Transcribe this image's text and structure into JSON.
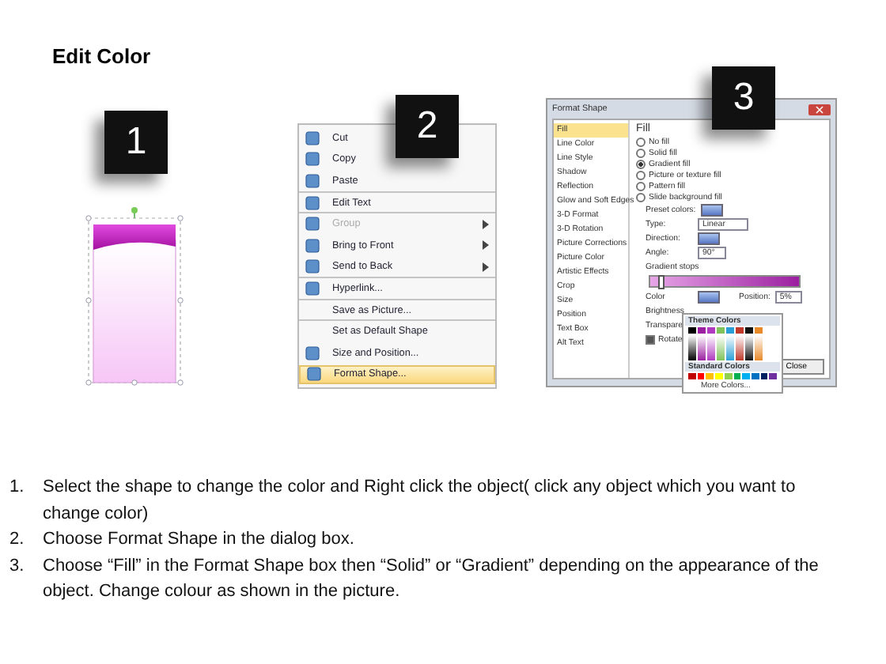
{
  "title": "Edit Color",
  "badges": [
    "1",
    "2",
    "3"
  ],
  "menu": [
    {
      "label": "Cut",
      "icon": true,
      "disabled": false,
      "submenu": false,
      "selected": false,
      "separator_after": false
    },
    {
      "label": "Copy",
      "icon": true,
      "disabled": false,
      "submenu": false,
      "selected": false,
      "separator_after": false
    },
    {
      "label": "Paste",
      "icon": true,
      "disabled": false,
      "submenu": false,
      "selected": false,
      "separator_after": true
    },
    {
      "label": "Edit Text",
      "icon": true,
      "disabled": false,
      "submenu": false,
      "selected": false,
      "separator_after": true
    },
    {
      "label": "Group",
      "icon": true,
      "disabled": true,
      "submenu": true,
      "selected": false,
      "separator_after": false
    },
    {
      "label": "Bring to Front",
      "icon": true,
      "disabled": false,
      "submenu": true,
      "selected": false,
      "separator_after": false
    },
    {
      "label": "Send to Back",
      "icon": true,
      "disabled": false,
      "submenu": true,
      "selected": false,
      "separator_after": true
    },
    {
      "label": "Hyperlink...",
      "icon": true,
      "disabled": false,
      "submenu": false,
      "selected": false,
      "separator_after": true
    },
    {
      "label": "Save as Picture...",
      "icon": false,
      "disabled": false,
      "submenu": false,
      "selected": false,
      "separator_after": true
    },
    {
      "label": "Set as Default Shape",
      "icon": false,
      "disabled": false,
      "submenu": false,
      "selected": false,
      "separator_after": false
    },
    {
      "label": "Size and Position...",
      "icon": true,
      "disabled": false,
      "submenu": false,
      "selected": false,
      "separator_after": false
    },
    {
      "label": "Format Shape...",
      "icon": true,
      "disabled": false,
      "submenu": false,
      "selected": true,
      "separator_after": false
    }
  ],
  "dialog": {
    "title": "Format Shape",
    "sidebar": [
      {
        "label": "Fill",
        "selected": true
      },
      {
        "label": "Line Color",
        "selected": false
      },
      {
        "label": "Line Style",
        "selected": false
      },
      {
        "label": "Shadow",
        "selected": false
      },
      {
        "label": "Reflection",
        "selected": false
      },
      {
        "label": "Glow and Soft Edges",
        "selected": false
      },
      {
        "label": "3-D Format",
        "selected": false
      },
      {
        "label": "3-D Rotation",
        "selected": false
      },
      {
        "label": "Picture Corrections",
        "selected": false
      },
      {
        "label": "Picture Color",
        "selected": false
      },
      {
        "label": "Artistic Effects",
        "selected": false
      },
      {
        "label": "Crop",
        "selected": false
      },
      {
        "label": "Size",
        "selected": false
      },
      {
        "label": "Position",
        "selected": false
      },
      {
        "label": "Text Box",
        "selected": false
      },
      {
        "label": "Alt Text",
        "selected": false
      }
    ],
    "heading": "Fill",
    "options": [
      {
        "label": "No fill",
        "selected": false
      },
      {
        "label": "Solid fill",
        "selected": false
      },
      {
        "label": "Gradient fill",
        "selected": true
      },
      {
        "label": "Picture or texture fill",
        "selected": false
      },
      {
        "label": "Pattern fill",
        "selected": false
      },
      {
        "label": "Slide background fill",
        "selected": false
      }
    ],
    "preset_label": "Preset colors:",
    "type_label": "Type:",
    "type_value": "Linear",
    "direction_label": "Direction:",
    "angle_label": "Angle:",
    "angle_value": "90°",
    "stops_label": "Gradient stops",
    "color_label": "Color",
    "position_label": "Position:",
    "position_value": "5%",
    "brightness_label": "Brightness",
    "transparency_label": "Transpare",
    "rotate_label": "Rotate",
    "rotate_checked": true,
    "gradient_stop": {
      "level": 0.05
    },
    "close": "Close"
  },
  "palette": {
    "theme_title": "Theme Colors",
    "theme": [
      {
        "color": "#000000"
      },
      {
        "color": "#9b1fa0"
      },
      {
        "color": "#b03ac0"
      },
      {
        "color": "#7fc35a"
      },
      {
        "color": "#2a9fd6"
      },
      {
        "color": "#c0392b"
      },
      {
        "color": "#111111"
      },
      {
        "color": "#e8892a"
      }
    ],
    "standard_title": "Standard Colors",
    "standard": [
      {
        "color": "#c00000"
      },
      {
        "color": "#ff0000"
      },
      {
        "color": "#ffc000"
      },
      {
        "color": "#ffff00"
      },
      {
        "color": "#92d050"
      },
      {
        "color": "#00b050"
      },
      {
        "color": "#00b0f0"
      },
      {
        "color": "#0070c0"
      },
      {
        "color": "#002060"
      },
      {
        "color": "#7030a0"
      }
    ],
    "more": "More Colors..."
  },
  "steps": [
    {
      "number": "1.",
      "text": "Select the shape to change the color and Right click the object( click any object which you want to change color)"
    },
    {
      "number": "2.",
      "text": "Choose Format Shape in the dialog box."
    },
    {
      "number": "3.",
      "text": "Choose “Fill” in the Format Shape box then “Solid” or “Gradient” depending on the appearance of the object. Change colour as shown in the picture."
    }
  ]
}
